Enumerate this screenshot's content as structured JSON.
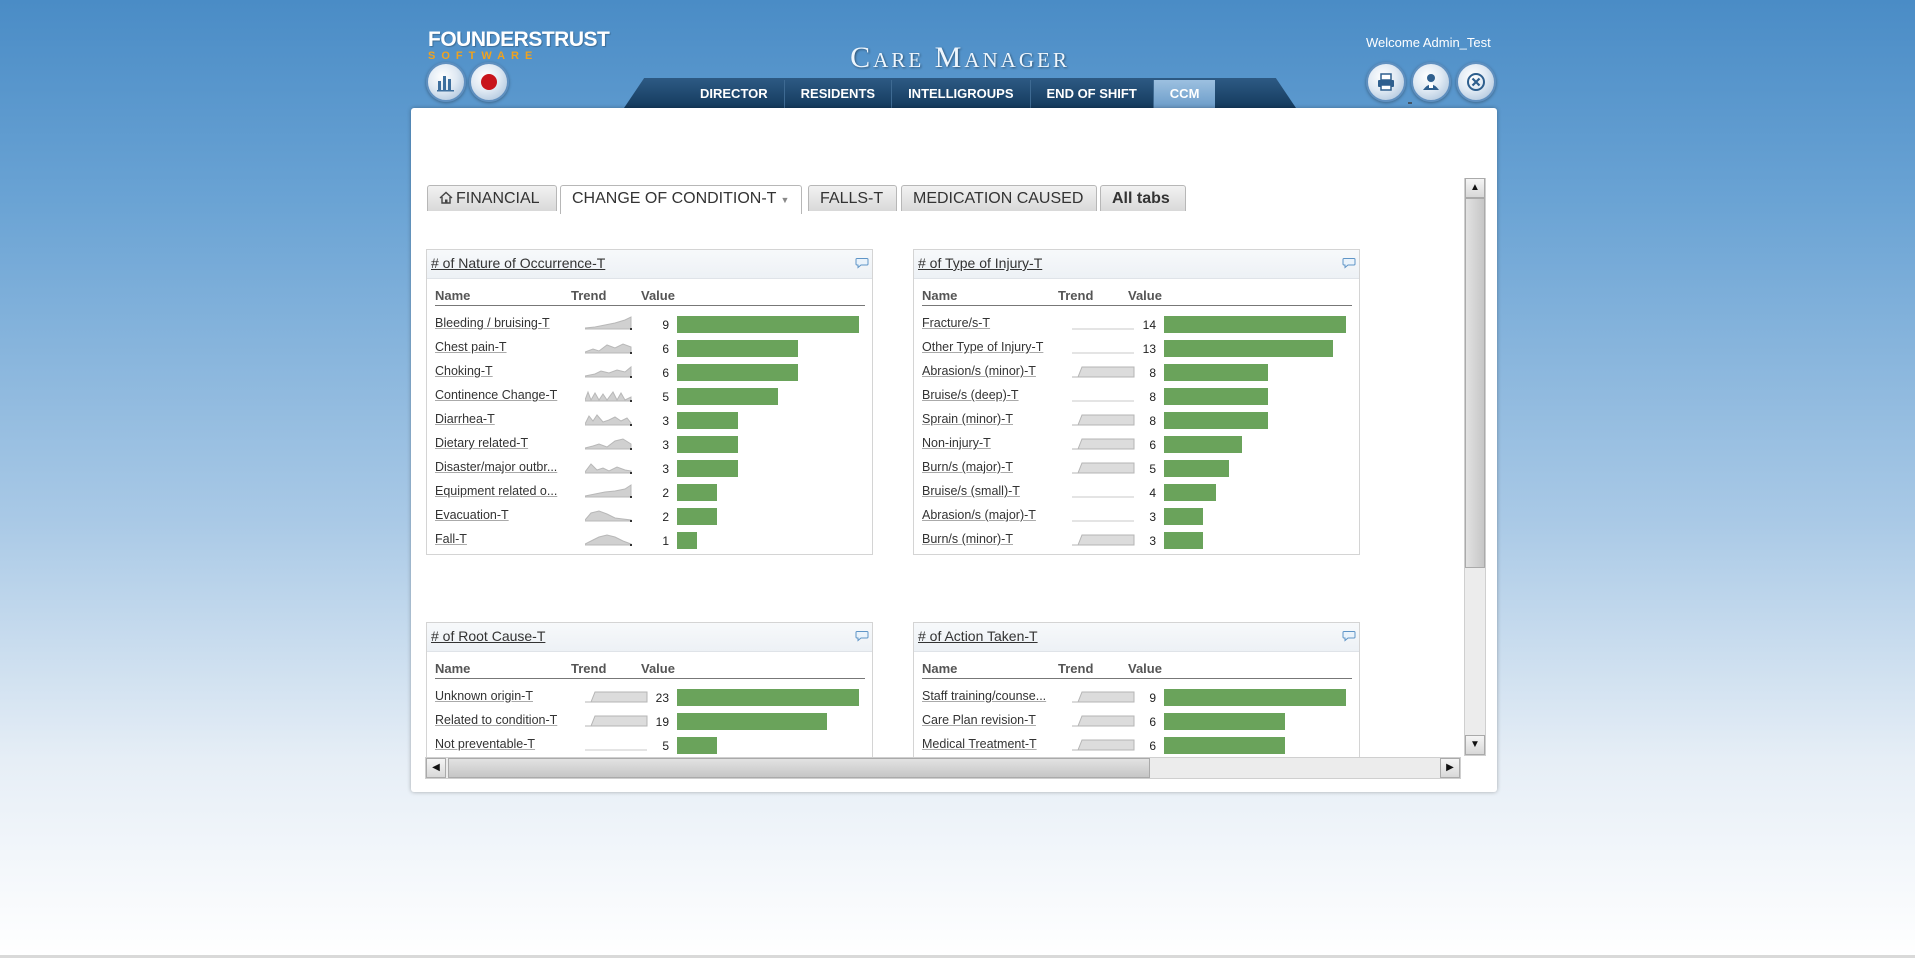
{
  "header": {
    "logo_main": "FOUNDERSTRUST",
    "logo_sub": "SOFTWARE",
    "app_title": "Care Manager",
    "welcome": "Welcome Admin_Test"
  },
  "nav": [
    "DIRECTOR",
    "RESIDENTS",
    "INTELLIGROUPS",
    "END OF SHIFT",
    "CCM"
  ],
  "nav_active": "CCM",
  "tabs": {
    "financial": "FINANCIAL",
    "change_of_condition": "CHANGE OF CONDITION-T",
    "falls": "FALLS-T",
    "medication": "MEDICATION CAUSED",
    "all": "All tabs"
  },
  "columns": {
    "name": "Name",
    "trend": "Trend",
    "value": "Value"
  },
  "widgets": {
    "nature": {
      "title": "# of Nature of Occurrence-T",
      "rows": [
        {
          "name": "Bleeding / bruising-T",
          "value": "9"
        },
        {
          "name": "Chest pain-T",
          "value": "6"
        },
        {
          "name": "Choking-T",
          "value": "6"
        },
        {
          "name": "Continence Change-T",
          "value": "5"
        },
        {
          "name": "Diarrhea-T",
          "value": "3"
        },
        {
          "name": "Dietary related-T",
          "value": "3"
        },
        {
          "name": "Disaster/major outbr...",
          "value": "3"
        },
        {
          "name": "Equipment related o...",
          "value": "2"
        },
        {
          "name": "Evacuation-T",
          "value": "2"
        },
        {
          "name": "Fall-T",
          "value": "1"
        }
      ]
    },
    "injury": {
      "title": "# of Type of Injury-T",
      "rows": [
        {
          "name": "Fracture/s-T",
          "value": "14"
        },
        {
          "name": "Other Type of Injury-T",
          "value": "13"
        },
        {
          "name": "Abrasion/s (minor)-T",
          "value": "8"
        },
        {
          "name": "Bruise/s (deep)-T",
          "value": "8"
        },
        {
          "name": "Sprain (minor)-T",
          "value": "8"
        },
        {
          "name": "Non-injury-T",
          "value": "6"
        },
        {
          "name": "Burn/s (major)-T",
          "value": "5"
        },
        {
          "name": "Bruise/s (small)-T",
          "value": "4"
        },
        {
          "name": "Abrasion/s (major)-T",
          "value": "3"
        },
        {
          "name": "Burn/s (minor)-T",
          "value": "3"
        }
      ]
    },
    "root": {
      "title": "# of Root Cause-T",
      "rows": [
        {
          "name": "Unknown origin-T",
          "value": "23"
        },
        {
          "name": "Related to condition-T",
          "value": "19"
        },
        {
          "name": "Not preventable-T",
          "value": "5"
        }
      ]
    },
    "action": {
      "title": "# of Action Taken-T",
      "rows": [
        {
          "name": "Staff training/counse...",
          "value": "9"
        },
        {
          "name": "Care Plan revision-T",
          "value": "6"
        },
        {
          "name": "Medical Treatment-T",
          "value": "6"
        }
      ]
    }
  },
  "colors": {
    "bar": "#6aa35b",
    "nav_bg": "#143a5d",
    "accent_orange": "#f0a21e"
  }
}
